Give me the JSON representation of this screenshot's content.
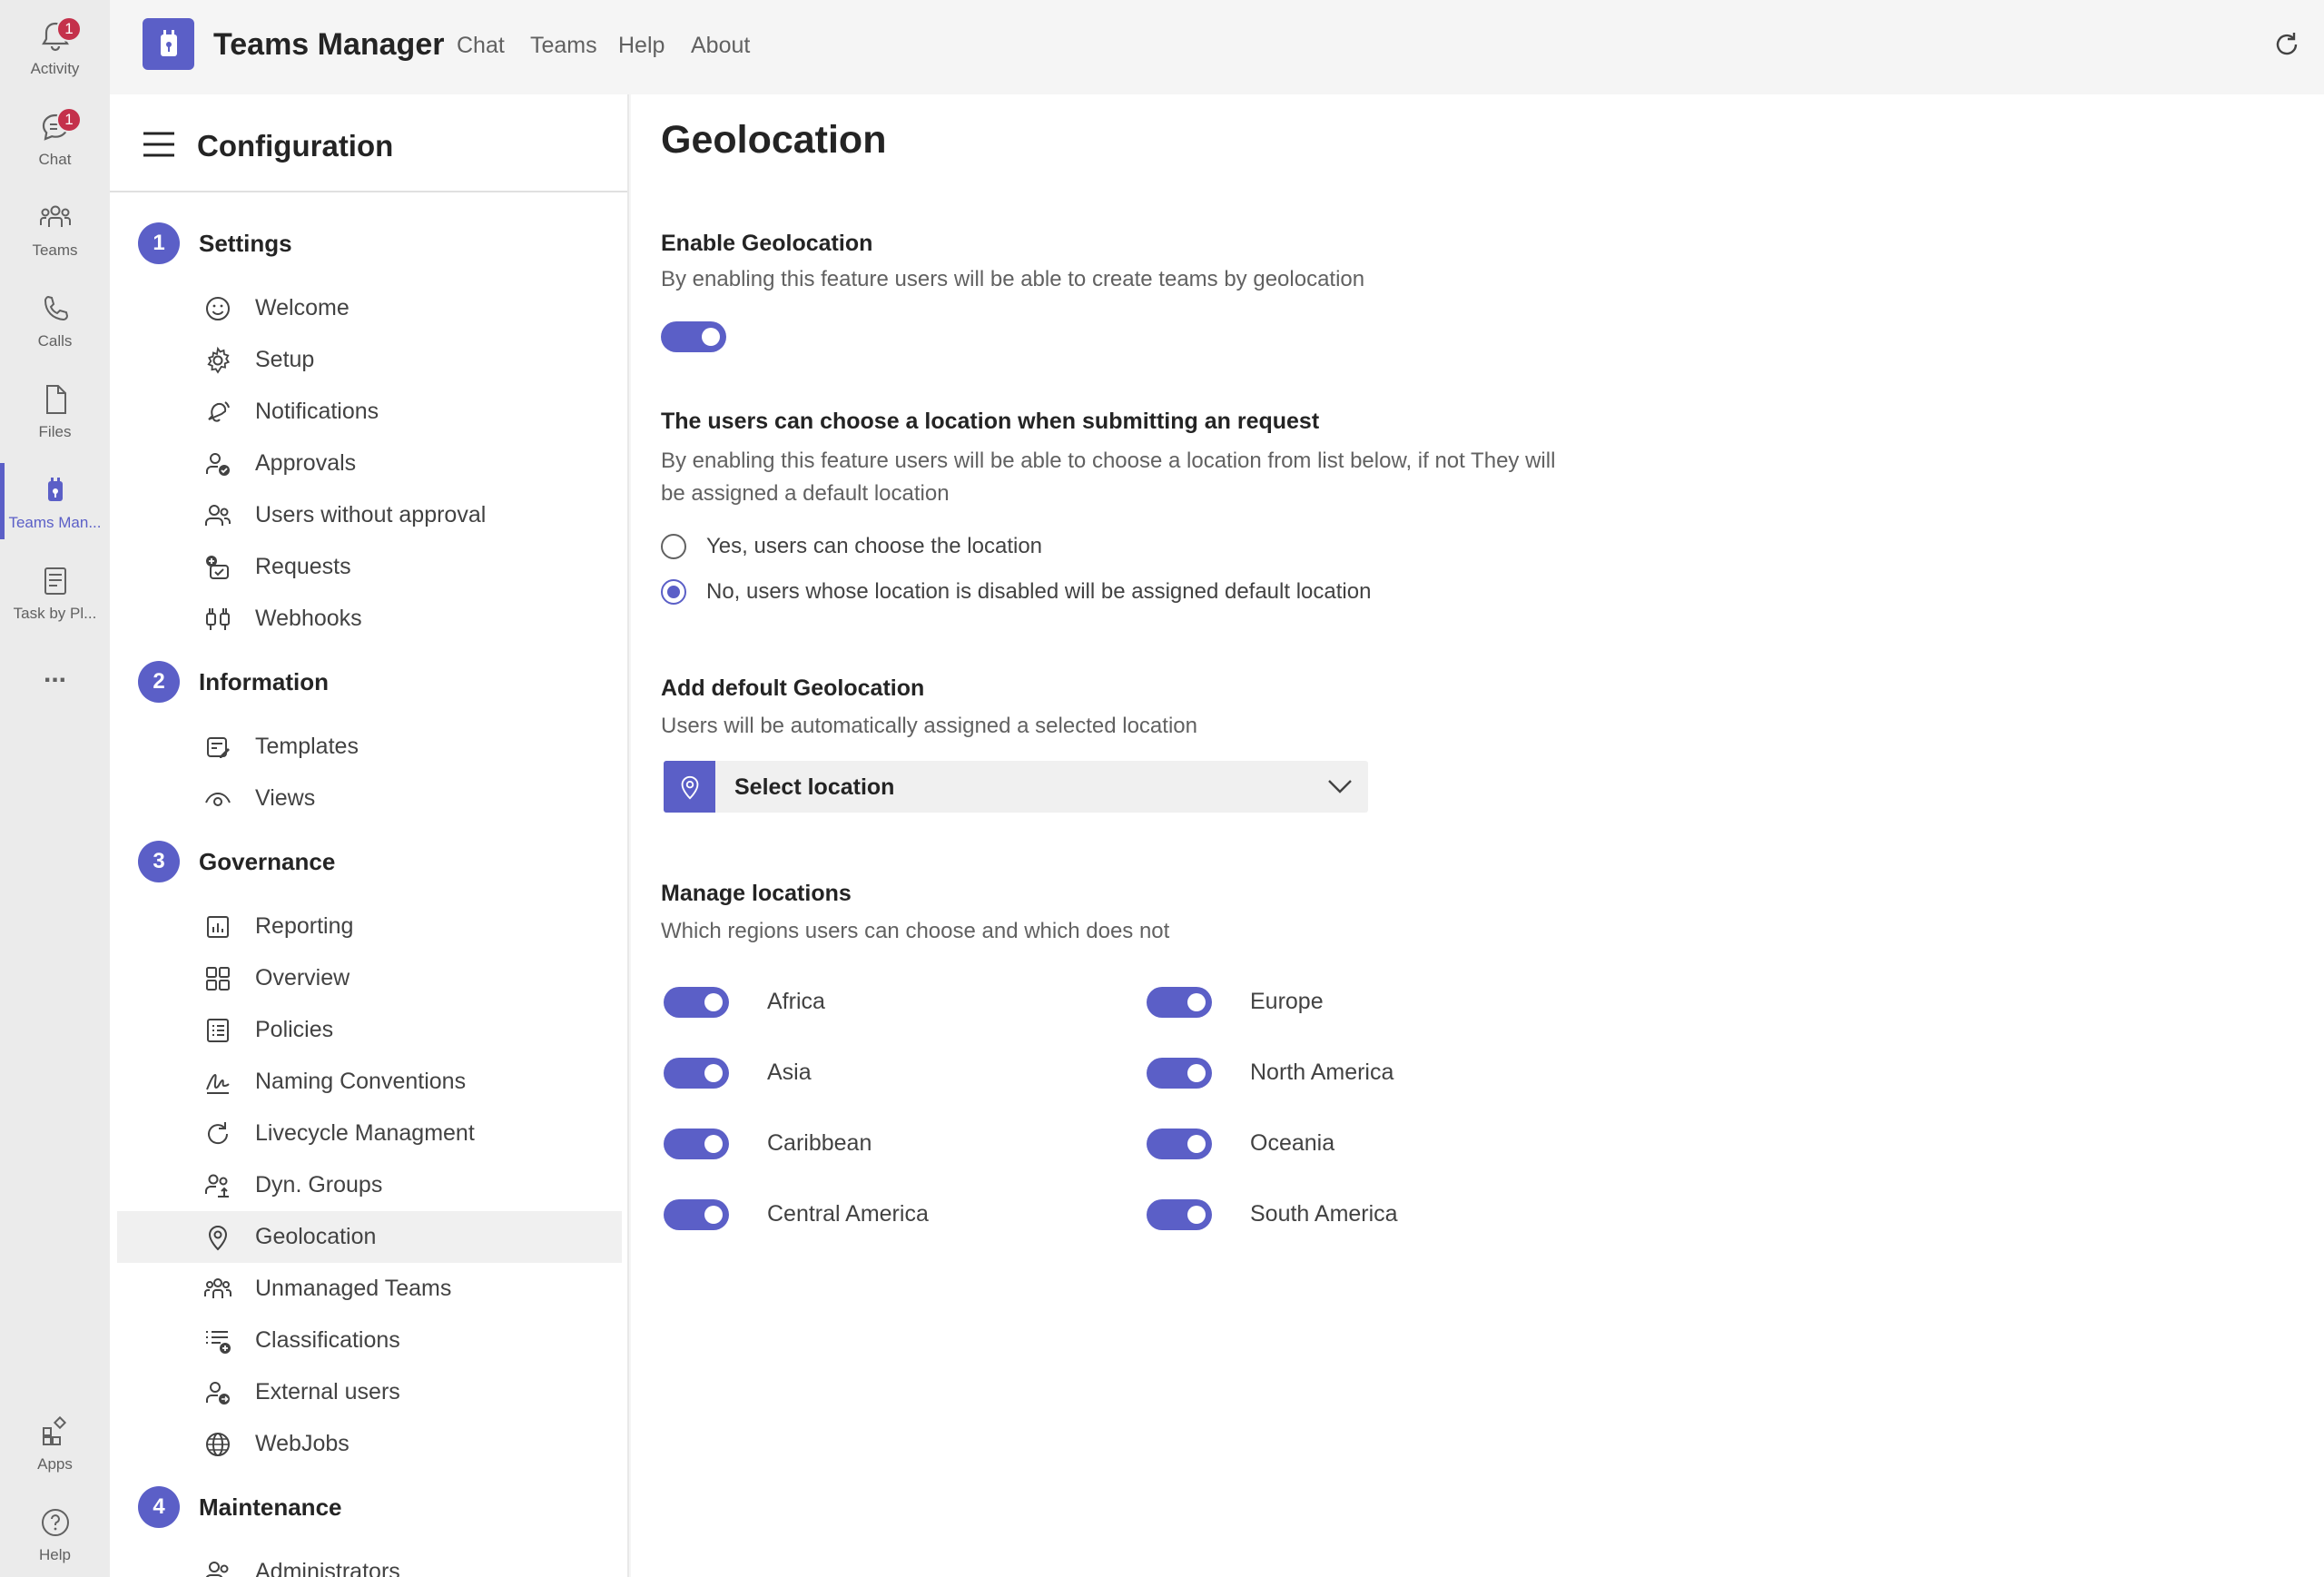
{
  "rail": {
    "items": [
      {
        "label": "Activity",
        "icon": "bell-icon",
        "badge": "1"
      },
      {
        "label": "Chat",
        "icon": "chat-icon",
        "badge": "1"
      },
      {
        "label": "Teams",
        "icon": "teams-icon"
      },
      {
        "label": "Calls",
        "icon": "phone-icon"
      },
      {
        "label": "Files",
        "icon": "file-icon"
      },
      {
        "label": "Teams Man...",
        "icon": "teams-manager-icon"
      },
      {
        "label": "Task by Pl...",
        "icon": "task-icon"
      }
    ],
    "more": "...",
    "bottom": [
      {
        "label": "Apps",
        "icon": "apps-icon"
      },
      {
        "label": "Help",
        "icon": "help-icon"
      }
    ]
  },
  "header": {
    "app_title": "Teams Manager",
    "tabs": [
      "Chat",
      "Teams",
      "Help",
      "About"
    ]
  },
  "config": {
    "title": "Configuration",
    "sections": [
      {
        "num": "1",
        "title": "Settings",
        "items": [
          "Welcome",
          "Setup",
          "Notifications",
          "Approvals",
          "Users without approval",
          "Requests",
          "Webhooks"
        ]
      },
      {
        "num": "2",
        "title": "Information",
        "items": [
          "Templates",
          "Views"
        ]
      },
      {
        "num": "3",
        "title": "Governance",
        "items": [
          "Reporting",
          "Overview",
          "Policies",
          "Naming Conventions",
          "Livecycle Managment",
          "Dyn. Groups",
          "Geolocation",
          "Unmanaged Teams",
          "Classifications",
          "External users",
          "WebJobs"
        ]
      },
      {
        "num": "4",
        "title": "Maintenance",
        "items": [
          "Administrators"
        ]
      }
    ],
    "selected": "Geolocation"
  },
  "main": {
    "title": "Geolocation",
    "enable": {
      "title": "Enable Geolocation",
      "desc": "By enabling this feature users will be able to create teams by geolocation",
      "on": true
    },
    "choose": {
      "title": "The users can choose a location when submitting an request",
      "desc1": "By enabling this feature users will be able to choose a location from list below, if not They will",
      "desc2": "be assigned a default location",
      "options": [
        "Yes, users can choose the location",
        "No, users whose location is disabled will be assigned default location"
      ],
      "selected_index": 1
    },
    "default": {
      "title": "Add defoult Geolocation",
      "desc": "Users will be automatically assigned a selected location",
      "dropdown": "Select location"
    },
    "manage": {
      "title": "Manage locations",
      "desc": "Which regions users can choose and which does not",
      "regions_left": [
        "Africa",
        "Asia",
        "Caribbean",
        "Central America"
      ],
      "regions_right": [
        "Europe",
        "North America",
        "Oceania",
        "South America"
      ]
    }
  },
  "colors": {
    "accent": "#5b5fc7",
    "badge": "#c4314b"
  }
}
